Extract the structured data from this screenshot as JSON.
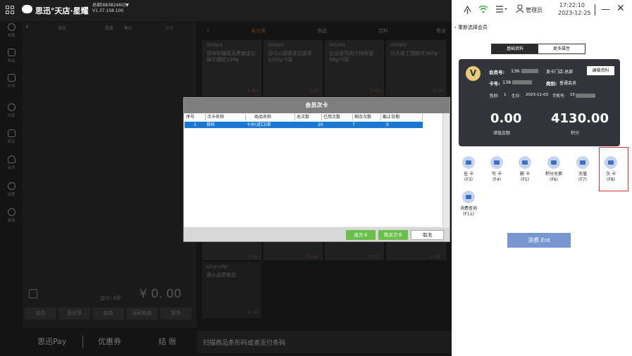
{
  "topbar": {
    "app_title": "思迅°天店·星耀",
    "shop_line1": "总部[68382460]▼",
    "shop_line2": "V1.37.158.100",
    "user": "管理员",
    "time": "17:22:10",
    "date": "2023-12-25",
    "minimize": "—",
    "close": "✕"
  },
  "sidebar": {
    "items": [
      {
        "label": "收银",
        "icon": "register-icon"
      },
      {
        "label": "商品",
        "icon": "product-icon"
      },
      {
        "label": "外卖",
        "icon": "delivery-icon"
      },
      {
        "label": "交易",
        "icon": "transaction-icon"
      },
      {
        "label": "库存",
        "icon": "warehouse-icon"
      },
      {
        "label": "会员",
        "icon": "member-icon"
      },
      {
        "label": "设置",
        "icon": "settings-icon"
      },
      {
        "label": "客服",
        "icon": "support-icon"
      }
    ],
    "bottom_label": "店面"
  },
  "cart": {
    "headers": [
      "#",
      "品名",
      "数量",
      "售价",
      "小计"
    ],
    "total_label": "合计: 0件",
    "total_amount": "¥ 0. 00",
    "buttons": [
      "会员",
      "营业员",
      "取单",
      "无码商品",
      "更多"
    ]
  },
  "categories": {
    "back": "‹",
    "tabs": [
      "未分类",
      "饰品",
      "饮料",
      "零食"
    ]
  },
  "products": [
    {
      "code": "005964",
      "name": "佰味彩糖面无蔗糖金拉姆牛腰肚199g",
      "price": "0.00"
    },
    {
      "code": "005965",
      "name": "百吗火腿面条拉面条1/20g*5袋",
      "price": "0.00"
    },
    {
      "code": "005966",
      "name": "五谷道场肉汁排骨面98g*5袋",
      "price": "0.00"
    },
    {
      "code": "005969",
      "name": "马大姐丁图甜点360g",
      "price": "0.00"
    }
  ],
  "product_row4_prices": [
    "5.00",
    "70.00",
    "0.00",
    "0.00"
  ],
  "product_extra": {
    "code": "o2oyunfei",
    "name": "微小运费商品",
    "price": "0.00"
  },
  "bottombar": {
    "pay": "思迅Pay",
    "coupon": "优惠券",
    "checkout": "结 账",
    "scan_placeholder": "扫描商品条形码或者支付条码"
  },
  "dialog": {
    "title": "会员次卡",
    "headers": [
      "序号",
      "次卡名称",
      "商品名称",
      "总次数",
      "已用次数",
      "剩余次数",
      "截止日期"
    ],
    "row": {
      "index": "1",
      "card_name": "骨科",
      "product": "十价(进口)单",
      "total": "20",
      "used": "7",
      "remaining": "0",
      "deadline": ""
    },
    "buttons": {
      "return": "退次卡",
      "buy": "购买次卡",
      "cancel": "取消"
    }
  },
  "member": {
    "back_label": "重新选择会员",
    "tabs": {
      "basic": "基础资料",
      "more": "更多属性"
    },
    "logo": "V",
    "member_no_label": "会员号:",
    "member_no": "136          85",
    "status": "发卡门店:总部",
    "card_no_label": "卡号:",
    "card_no": "136          385",
    "category_label": "类别:",
    "category": "普通会员",
    "gender_label": "性别:",
    "gender": "1",
    "birthday_label": "生日:",
    "birthday": "2023-11-03",
    "phone_label": "手机号:",
    "phone": "15",
    "edit_button": "编辑资料",
    "balance": "0.00",
    "balance_label": "储值金额",
    "points": "4130.00",
    "points_label": "积分",
    "actions": [
      {
        "label": "挂 卡",
        "key": "(F3)",
        "icon": "card-icon"
      },
      {
        "label": "写 卡",
        "key": "(F4)",
        "icon": "write-card-icon"
      },
      {
        "label": "删 卡",
        "key": "(F5)",
        "icon": "delete-card-icon"
      },
      {
        "label": "积分兑换",
        "key": "(F6)",
        "icon": "gift-icon"
      },
      {
        "label": "充值",
        "key": "(F7)",
        "icon": "recharge-icon"
      },
      {
        "label": "次 卡",
        "key": "(F8)",
        "icon": "times-card-icon"
      },
      {
        "label": "消费查询",
        "key": "(F11)",
        "icon": "query-icon"
      }
    ],
    "consume_button": "消费 Ent"
  }
}
